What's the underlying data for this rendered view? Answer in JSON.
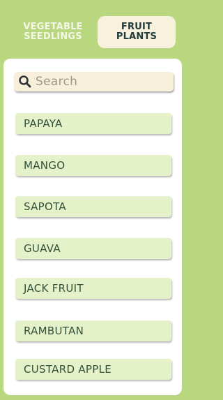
{
  "tabs": {
    "vegetable": {
      "line1": "VEGETABLE",
      "line2": "SEEDLINGS"
    },
    "fruit": {
      "line1": "FRUIT",
      "line2": "PLANTS"
    }
  },
  "search": {
    "placeholder": "Search",
    "icon": "search-icon"
  },
  "fruit_plants": [
    "PAPAYA",
    "MANGO",
    "SAPOTA",
    "GUAVA",
    "JACK FRUIT",
    "RAMBUTAN",
    "CUSTARD APPLE"
  ],
  "colors": {
    "background": "#b9d77e",
    "active_tab": "#f7f1de",
    "item_background": "#e4f1c9",
    "item_text": "#33513a"
  }
}
